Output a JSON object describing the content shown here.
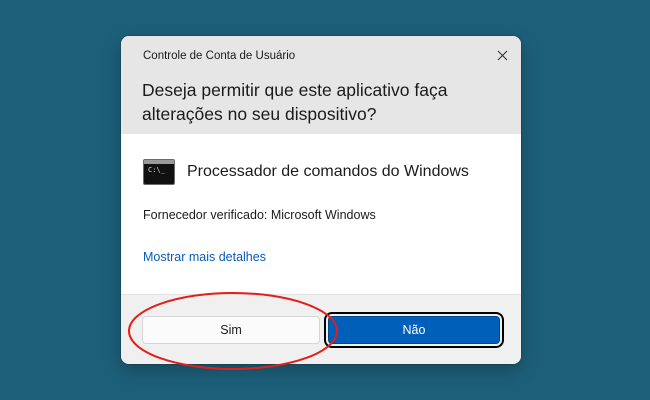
{
  "dialog": {
    "caption": "Controle de Conta de Usuário",
    "question": "Deseja permitir que este aplicativo faça alterações no seu dispositivo?",
    "app_name": "Processador de comandos do Windows",
    "publisher": "Fornecedor verificado: Microsoft Windows",
    "details_link": "Mostrar mais detalhes",
    "yes_label": "Sim",
    "no_label": "Não",
    "icons": {
      "close": "close-icon",
      "app": "command-prompt-icon"
    }
  },
  "colors": {
    "desktop_background": "#1d5f79",
    "header_background": "#e6e6e6",
    "primary_button": "#005fb8",
    "link": "#0a5bb5",
    "highlight_annotation": "#e0201b"
  }
}
